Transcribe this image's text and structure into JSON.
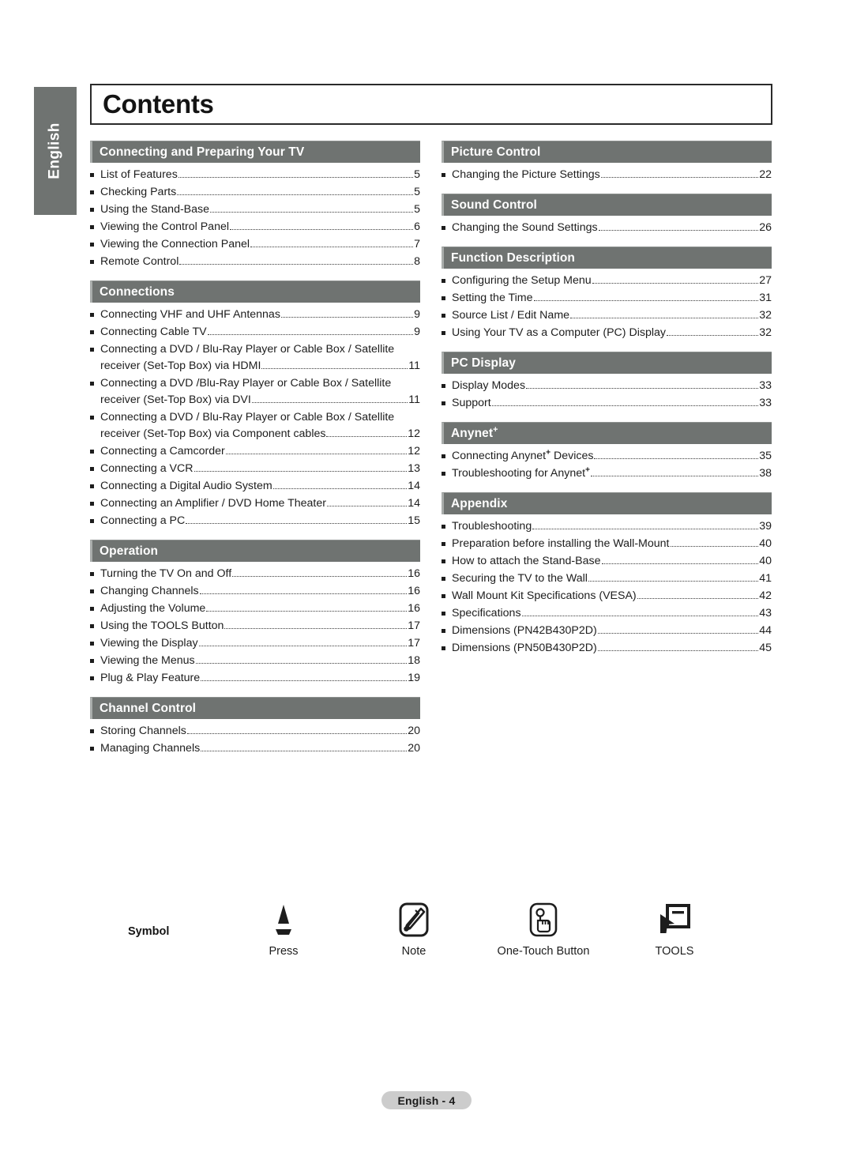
{
  "page": {
    "title": "Contents",
    "side_tab_label": "English",
    "footer_label": "English - 4"
  },
  "left_column": [
    {
      "header": "Connecting and Preparing Your TV",
      "entries": [
        {
          "text": "List of Features",
          "page": "5"
        },
        {
          "text": "Checking Parts",
          "page": "5"
        },
        {
          "text": "Using the Stand-Base",
          "page": "5"
        },
        {
          "text": "Viewing the Control Panel",
          "page": "6"
        },
        {
          "text": "Viewing the Connection Panel",
          "page": "7"
        },
        {
          "text": "Remote Control",
          "page": "8"
        }
      ]
    },
    {
      "header": "Connections",
      "entries": [
        {
          "text": "Connecting VHF and UHF Antennas",
          "page": "9"
        },
        {
          "text": "Connecting Cable TV",
          "page": "9"
        },
        {
          "text": "Connecting a DVD / Blu-Ray Player or Cable Box / Satellite",
          "text2": "receiver (Set-Top Box) via HDMI",
          "page": "11"
        },
        {
          "text": "Connecting a DVD /Blu-Ray Player or Cable Box / Satellite",
          "text2": "receiver (Set-Top Box) via DVI",
          "page": "11"
        },
        {
          "text": "Connecting a DVD / Blu-Ray Player or Cable Box / Satellite",
          "text2": "receiver (Set-Top Box) via Component cables",
          "page": "12"
        },
        {
          "text": "Connecting a Camcorder",
          "page": "12"
        },
        {
          "text": "Connecting a VCR",
          "page": "13"
        },
        {
          "text": "Connecting a Digital Audio System",
          "page": "14"
        },
        {
          "text": "Connecting an Amplifier / DVD Home Theater",
          "page": "14"
        },
        {
          "text": "Connecting a PC",
          "page": "15"
        }
      ]
    },
    {
      "header": "Operation",
      "entries": [
        {
          "text": "Turning the TV On and Off",
          "page": "16"
        },
        {
          "text": "Changing Channels",
          "page": "16"
        },
        {
          "text": "Adjusting the Volume",
          "page": "16"
        },
        {
          "text": "Using the TOOLS Button",
          "page": "17"
        },
        {
          "text": "Viewing the Display",
          "page": "17"
        },
        {
          "text": "Viewing the Menus",
          "page": "18"
        },
        {
          "text": "Plug & Play Feature",
          "page": "19"
        }
      ]
    },
    {
      "header": "Channel Control",
      "entries": [
        {
          "text": "Storing Channels",
          "page": "20"
        },
        {
          "text": "Managing Channels",
          "page": "20"
        }
      ]
    }
  ],
  "right_column": [
    {
      "header": "Picture Control",
      "entries": [
        {
          "text": "Changing the Picture Settings",
          "page": "22"
        }
      ]
    },
    {
      "header": "Sound Control",
      "entries": [
        {
          "text": "Changing the Sound Settings",
          "page": "26"
        }
      ]
    },
    {
      "header": "Function Description",
      "entries": [
        {
          "text": "Configuring the Setup Menu",
          "page": "27"
        },
        {
          "text": "Setting the Time",
          "page": "31"
        },
        {
          "text": "Source List / Edit Name",
          "page": "32"
        },
        {
          "text": "Using Your TV as a Computer (PC) Display",
          "page": "32"
        }
      ]
    },
    {
      "header": "PC Display",
      "entries": [
        {
          "text": "Display Modes",
          "page": "33"
        },
        {
          "text": "Support",
          "page": "33"
        }
      ]
    },
    {
      "header": "Anynet",
      "header_sup": "+",
      "entries": [
        {
          "text": "Connecting Anynet",
          "sup": "+",
          "text_after": " Devices",
          "page": "35"
        },
        {
          "text": "Troubleshooting for Anynet",
          "sup": "+",
          "text_after": "",
          "page": "38"
        }
      ]
    },
    {
      "header": "Appendix",
      "entries": [
        {
          "text": "Troubleshooting",
          "page": "39"
        },
        {
          "text": "Preparation before installing the Wall-Mount",
          "page": "40"
        },
        {
          "text": "How to attach the Stand-Base",
          "page": "40"
        },
        {
          "text": "Securing the TV to the Wall",
          "page": "41"
        },
        {
          "text": "Wall Mount Kit Specifications (VESA)",
          "page": "42"
        },
        {
          "text": "Specifications",
          "page": "43"
        },
        {
          "text": "Dimensions (PN42B430P2D)",
          "page": "44"
        },
        {
          "text": "Dimensions (PN50B430P2D)",
          "page": "45"
        }
      ]
    }
  ],
  "legend": {
    "label": "Symbol",
    "symbols": [
      {
        "icon": "press-icon",
        "caption": "Press"
      },
      {
        "icon": "note-pencil-icon",
        "caption": "Note"
      },
      {
        "icon": "one-touch-button-icon",
        "caption": "One-Touch Button"
      },
      {
        "icon": "tools-cursor-icon",
        "caption": "TOOLS"
      }
    ]
  },
  "colors": {
    "header_bar": "#6f7371",
    "side_tab": "#6f7371",
    "footer_pill": "#cccccc",
    "text": "#1d1d1d"
  }
}
